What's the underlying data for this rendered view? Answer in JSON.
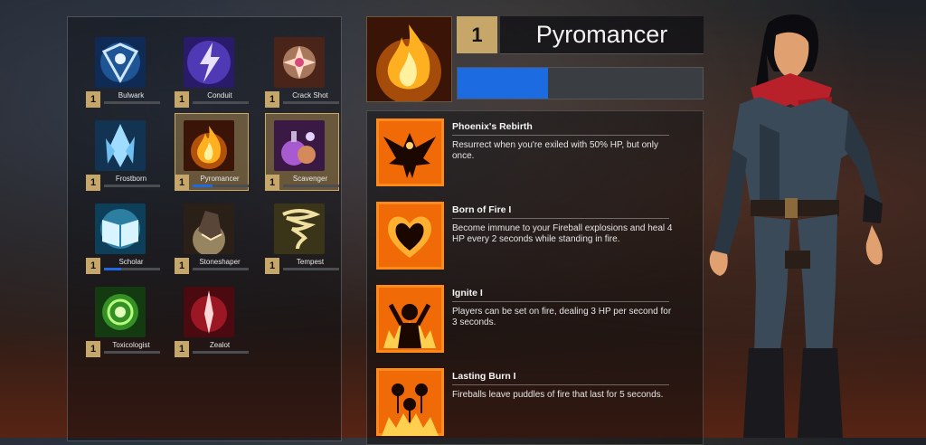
{
  "classes": [
    {
      "name": "Bulwark",
      "level": "1",
      "progress": 0
    },
    {
      "name": "Conduit",
      "level": "1",
      "progress": 0
    },
    {
      "name": "Crack Shot",
      "level": "1",
      "progress": 0
    },
    {
      "name": "Frostborn",
      "level": "1",
      "progress": 0
    },
    {
      "name": "Pyromancer",
      "level": "1",
      "progress": 0.35,
      "selected": true
    },
    {
      "name": "Scavenger",
      "level": "1",
      "progress": 0,
      "selected": true
    },
    {
      "name": "Scholar",
      "level": "1",
      "progress": 0.3
    },
    {
      "name": "Stoneshaper",
      "level": "1",
      "progress": 0
    },
    {
      "name": "Tempest",
      "level": "1",
      "progress": 0
    },
    {
      "name": "Toxicologist",
      "level": "1",
      "progress": 0
    },
    {
      "name": "Zealot",
      "level": "1",
      "progress": 0
    }
  ],
  "selected": {
    "level": "1",
    "title": "Pyromancer",
    "progress": 0.37
  },
  "perks": [
    {
      "title": "Phoenix's Rebirth",
      "description": "Resurrect when you're exiled with 50% HP, but only once.",
      "icon": "phoenix-icon"
    },
    {
      "title": "Born of Fire I",
      "description": "Become immune to your Fireball explosions and heal 4 HP every 2 seconds while standing in fire.",
      "icon": "flame-heart-icon"
    },
    {
      "title": "Ignite I",
      "description": "Players can be set on fire, dealing 3 HP per second for 3 seconds.",
      "icon": "burning-figure-icon"
    },
    {
      "title": "Lasting Burn I",
      "description": "Fireballs leave puddles of fire that last for 5 seconds.",
      "icon": "fire-drops-icon"
    }
  ],
  "colors": {
    "accent_gold": "#c6a769",
    "progress_blue": "#1d6be0"
  }
}
